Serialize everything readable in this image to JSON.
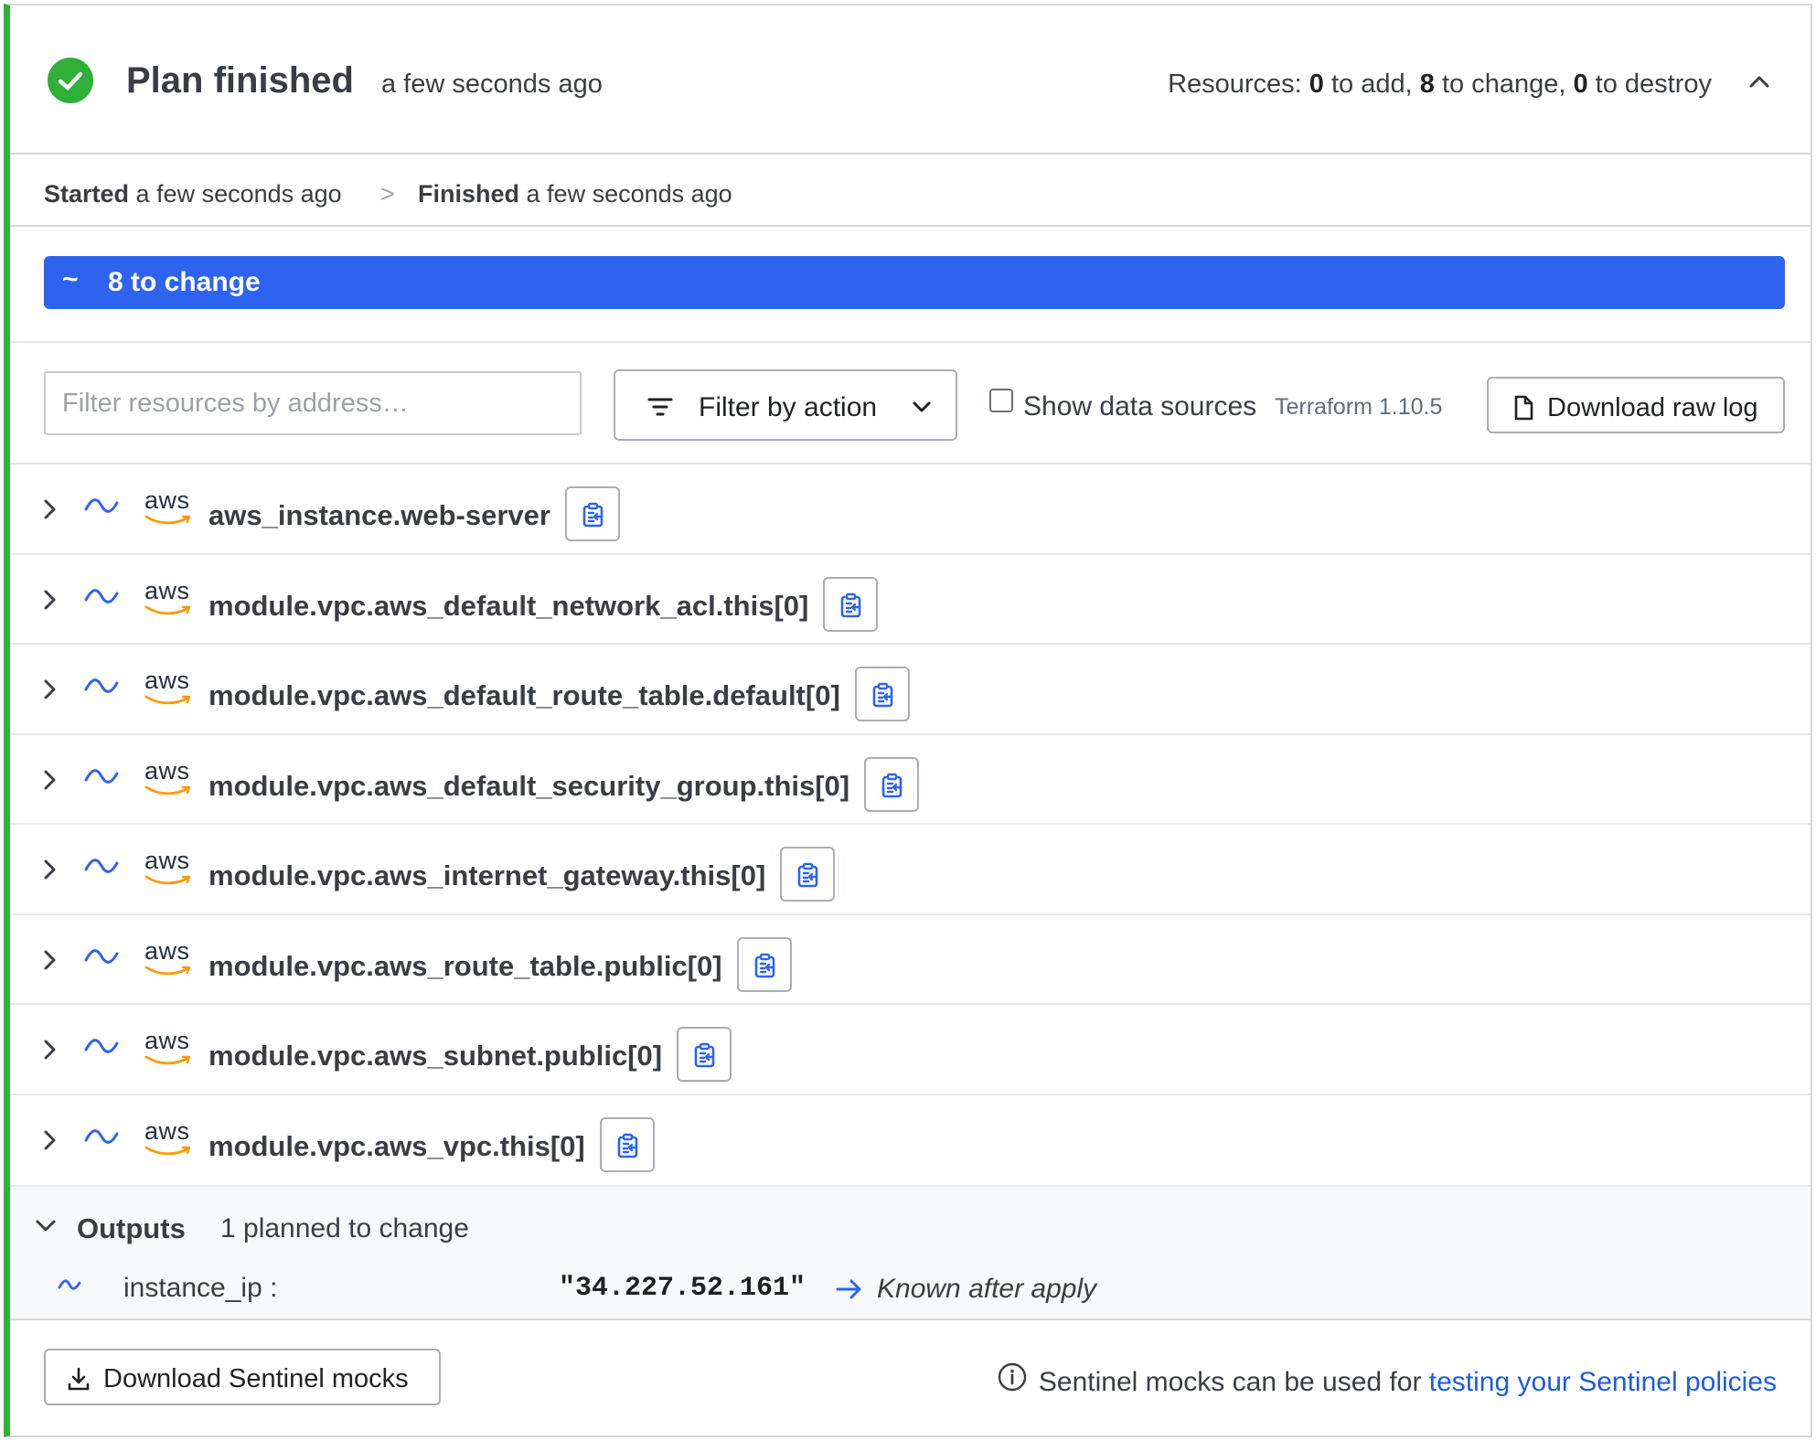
{
  "header": {
    "title": "Plan finished",
    "time": "a few seconds ago",
    "resources_prefix": "Resources: ",
    "add_count": "0",
    "add_label": " to add, ",
    "change_count": "8",
    "change_label": " to change, ",
    "destroy_count": "0",
    "destroy_label": " to destroy"
  },
  "timeline": {
    "started_label": "Started",
    "started_time": "a few seconds ago",
    "separator": ">",
    "finished_label": "Finished",
    "finished_time": "a few seconds ago"
  },
  "change_bar": {
    "symbol": "~",
    "label": "8 to change"
  },
  "toolbar": {
    "filter_placeholder": "Filter resources by address…",
    "filter_action_label": "Filter by action",
    "show_data_sources_label": "Show data sources",
    "terraform_version": "Terraform 1.10.5",
    "download_raw_log_label": "Download raw log"
  },
  "resources": [
    {
      "provider": "aws",
      "address": "aws_instance.web-server"
    },
    {
      "provider": "aws",
      "address": "module.vpc.aws_default_network_acl.this[0]"
    },
    {
      "provider": "aws",
      "address": "module.vpc.aws_default_route_table.default[0]"
    },
    {
      "provider": "aws",
      "address": "module.vpc.aws_default_security_group.this[0]"
    },
    {
      "provider": "aws",
      "address": "module.vpc.aws_internet_gateway.this[0]"
    },
    {
      "provider": "aws",
      "address": "module.vpc.aws_route_table.public[0]"
    },
    {
      "provider": "aws",
      "address": "module.vpc.aws_subnet.public[0]"
    },
    {
      "provider": "aws",
      "address": "module.vpc.aws_vpc.this[0]"
    }
  ],
  "outputs": {
    "title": "Outputs",
    "summary": "1 planned to change",
    "items": [
      {
        "name": "instance_ip :",
        "old_value": "\"34.227.52.161\"",
        "new_value": "Known after apply"
      }
    ]
  },
  "footer": {
    "download_sentinel_label": "Download Sentinel mocks",
    "note_text": "Sentinel mocks can be used for ",
    "note_link": "testing your Sentinel policies"
  },
  "colors": {
    "success": "#2eb039",
    "accent": "#2e63f0",
    "link": "#1c5be6",
    "aws_orange": "#ff9900"
  },
  "icons": {
    "status": "check-circle-icon",
    "collapse": "chevron-up-icon",
    "change": "tilde-icon",
    "filter": "filter-lines-icon",
    "dropdown": "chevron-down-icon",
    "file": "file-icon",
    "expand_row": "chevron-right-icon",
    "copy": "clipboard-copy-icon",
    "arrow": "arrow-right-icon",
    "download": "download-icon",
    "info": "info-icon"
  }
}
